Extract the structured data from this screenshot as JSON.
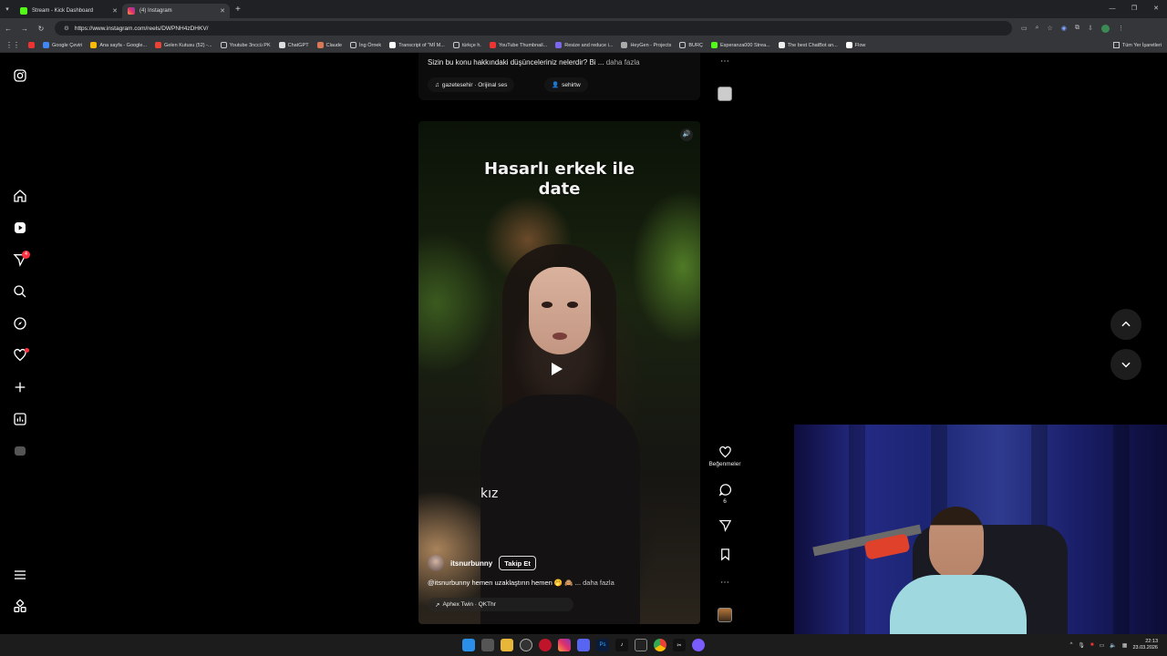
{
  "browser": {
    "tabs": [
      {
        "title": "Stream - Kick Dashboard",
        "color": "#53fc18",
        "active": false
      },
      {
        "title": "(4) Instagram",
        "color": "#e1306c",
        "active": true
      }
    ],
    "url": "https://www.instagram.com/reels/DWPNH4zDHKV/",
    "bookmarks": [
      "Google Çeviri",
      "Ana sayfa - Google...",
      "Gelen Kutusu (52) -...",
      "Youtube 3nccü PK",
      "ChatGPT",
      "Claude",
      "İng Örnek",
      "Transcript of \"Mİ M...",
      "türkçe h.",
      "YouTube Thumbnail...",
      "Resize and reduce i...",
      "HeyGen - Projects",
      "BURÇ",
      "Esperanza000 Strea...",
      "The best ChatBot an...",
      "Flow"
    ],
    "bookmarks_end": "Tüm Yer İşaretleri"
  },
  "sidebar": {
    "notifications_badge": "4"
  },
  "previous_reel": {
    "caption": "Sizin bu konu hakkındaki düşünceleriniz nelerdir? Bi ...",
    "caption_more": "daha fazla",
    "audio": "gazetesehir · Orijinal ses",
    "tagged_user": "sehirtw"
  },
  "reel": {
    "overlay_title_line1": "Hasarlı erkek ile",
    "overlay_title_line2": "date",
    "overlay_subtitle": "kız",
    "author": "itsnurbunny",
    "follow_label": "Takip Et",
    "caption": "@itsnurbunny hemen uzaklaştırın hemen 🤭 🙈 ...",
    "caption_more": "daha fazla",
    "audio": "Aphex Twin · QKThr"
  },
  "actions": {
    "like_label": "Beğenmeler",
    "comment_count": "6"
  },
  "taskbar": {
    "time": "22:13",
    "date": "23.03.2026"
  }
}
